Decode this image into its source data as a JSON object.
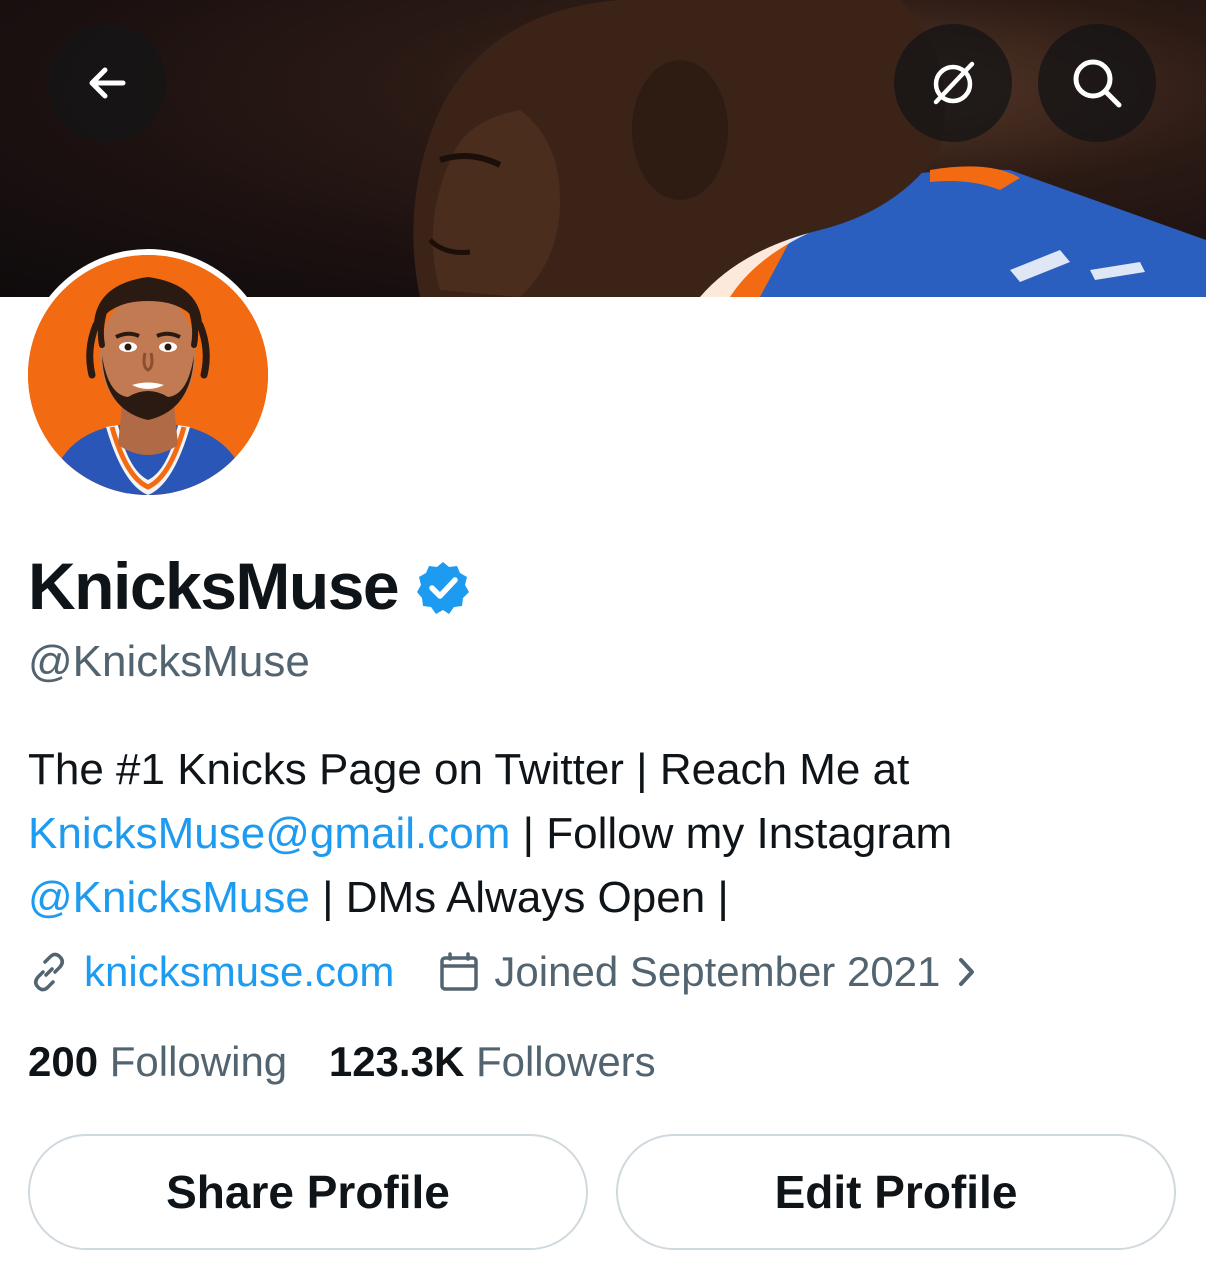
{
  "header": {
    "back_icon": "arrow-left-icon",
    "grok_icon": "slashed-circle-icon",
    "search_icon": "search-icon"
  },
  "profile": {
    "display_name": "KnicksMuse",
    "verified": true,
    "verified_color": "#1d9bf0",
    "handle": "@KnicksMuse",
    "bio": {
      "line1": "The #1 Knicks Page on Twitter | Reach Me at",
      "email": "KnicksMuse@gmail.com",
      "line2_rest": " | Follow my Instagram",
      "mention": "@KnicksMuse",
      "line3_rest": " | DMs Always Open |"
    },
    "website": "knicksmuse.com",
    "joined": "Joined September 2021"
  },
  "stats": {
    "following_count": "200",
    "following_label": "Following",
    "followers_count": "123.3K",
    "followers_label": "Followers"
  },
  "actions": {
    "share_label": "Share Profile",
    "edit_label": "Edit Profile"
  },
  "colors": {
    "accent": "#1d9bf0",
    "secondary_text": "#536471",
    "primary_text": "#0f1419",
    "avatar_bg": "#f26a12"
  }
}
